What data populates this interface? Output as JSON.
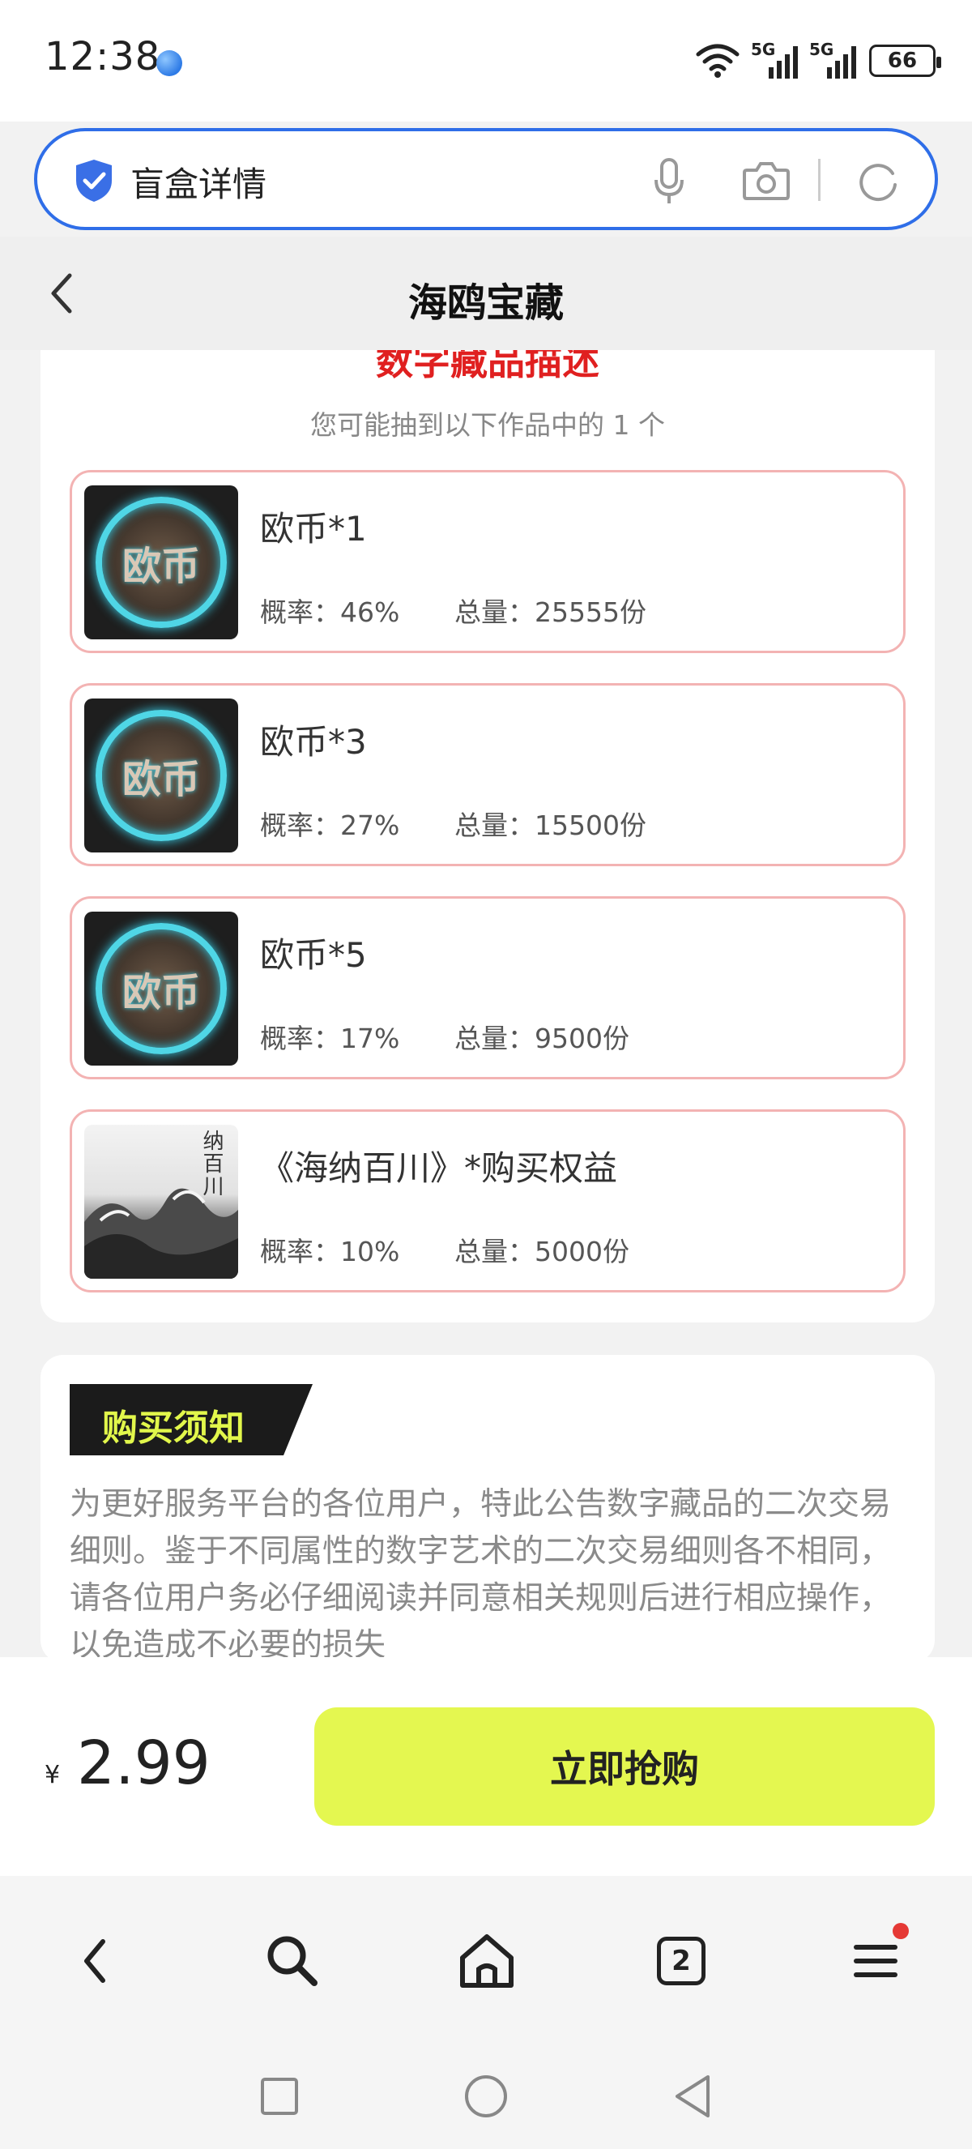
{
  "status_bar": {
    "time": "12:38",
    "signal1_label": "5G",
    "signal2_label": "5G",
    "battery": "66"
  },
  "search_bar": {
    "text": "盲盒详情"
  },
  "header": {
    "title": "海鸥宝藏"
  },
  "description": {
    "title": "数字藏品描述",
    "subtitle": "您可能抽到以下作品中的 1 个",
    "items": [
      {
        "name": "欧币*1",
        "probability": "概率：46%",
        "total": "总量：25555份",
        "thumb": "coin-image",
        "glyph": "欧币"
      },
      {
        "name": "欧币*3",
        "probability": "概率：27%",
        "total": "总量：15500份",
        "thumb": "coin-image",
        "glyph": "欧币"
      },
      {
        "name": "欧币*5",
        "probability": "概率：17%",
        "total": "总量：9500份",
        "thumb": "coin-image",
        "glyph": "欧币"
      },
      {
        "name": "《海纳百川》*购买权益",
        "probability": "概率：10%",
        "total": "总量：5000份",
        "thumb": "wave-painting",
        "glyph": "纳百川"
      }
    ]
  },
  "notice": {
    "tag": "购买须知",
    "body": "为更好服务平台的各位用户，特此公告数字藏品的二次交易细则。鉴于不同属性的数字艺术的二次交易细则各不相同，请各位用户务必仔细阅读并同意相关规则后进行相应操作，以免造成不必要的损失"
  },
  "purchase": {
    "currency": "¥",
    "price": "2.99",
    "button_label": "立即抢购"
  },
  "browser_nav": {
    "tab_count": "2",
    "icons": [
      "back-icon",
      "search-icon",
      "home-icon",
      "tabs-icon",
      "menu-icon"
    ]
  },
  "colors": {
    "accent_blue": "#2f6ee8",
    "title_red": "#e02020",
    "item_border": "#f3b3b3",
    "buy_button": "#e4f750",
    "notice_tag_text": "#e2f74b"
  }
}
